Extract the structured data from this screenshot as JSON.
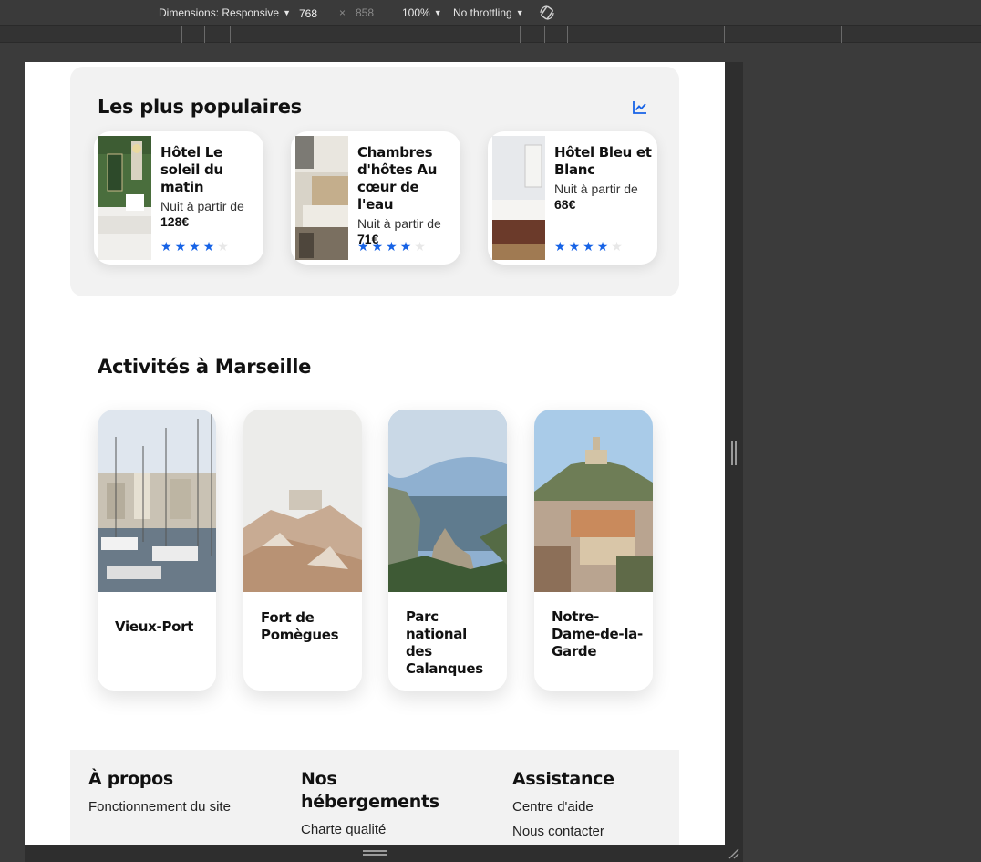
{
  "devtools": {
    "dimensions_label": "Dimensions: Responsive",
    "width": "768",
    "times": "×",
    "height": "858",
    "zoom": "100%",
    "throttling": "No throttling"
  },
  "popular": {
    "title": "Les plus populaires",
    "hotels": [
      {
        "name": "Hôtel Le soleil du matin",
        "price_prefix": "Nuit à partir de ",
        "price": "128€",
        "rating": 4,
        "max": 5
      },
      {
        "name": "Chambres d'hôtes Au cœur de l'eau",
        "price_prefix": "Nuit à partir de ",
        "price": "71€",
        "rating": 4,
        "max": 5
      },
      {
        "name": "Hôtel Bleu et Blanc",
        "price_prefix": "Nuit à partir de ",
        "price": "68€",
        "rating": 4,
        "max": 5
      }
    ]
  },
  "activities": {
    "title": "Activités à Marseille",
    "items": [
      {
        "label": "Vieux-Port"
      },
      {
        "label": "Fort de Pomègues"
      },
      {
        "label": "Parc national des Calanques"
      },
      {
        "label": "Notre-Dame-de-la-Garde"
      }
    ]
  },
  "footer": {
    "columns": [
      {
        "title": "À propos",
        "links": [
          "Fonctionnement du site"
        ]
      },
      {
        "title": "Nos hébergements",
        "links": [
          "Charte qualité"
        ]
      },
      {
        "title": "Assistance",
        "links": [
          "Centre d'aide",
          "Nous contacter"
        ]
      }
    ]
  },
  "colors": {
    "accent": "#1763e6",
    "panel": "#f2f2f2",
    "devtools_bg": "#3a3a3a"
  }
}
